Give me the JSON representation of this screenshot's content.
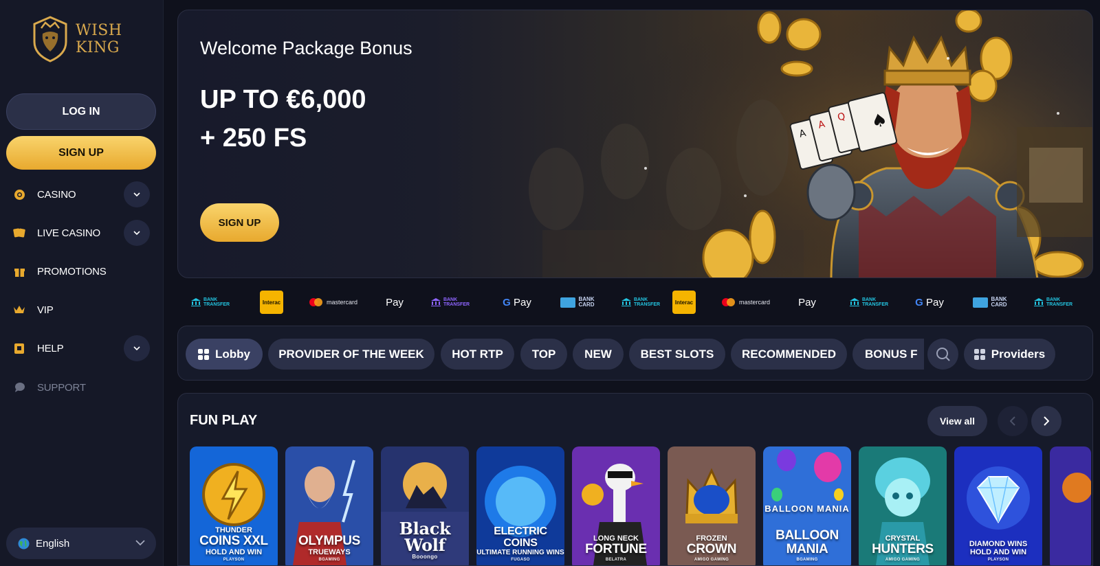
{
  "brand": {
    "line1": "WISH",
    "line2": "KING"
  },
  "auth": {
    "login_label": "LOG IN",
    "signup_label": "SIGN UP"
  },
  "sidebar": {
    "items": [
      {
        "label": "CASINO",
        "icon": "chip-icon",
        "expandable": true
      },
      {
        "label": "LIVE CASINO",
        "icon": "cards-icon",
        "expandable": true
      },
      {
        "label": "PROMOTIONS",
        "icon": "gift-icon",
        "expandable": false
      },
      {
        "label": "VIP",
        "icon": "crown-icon",
        "expandable": false
      },
      {
        "label": "HELP",
        "icon": "help-icon",
        "expandable": true
      },
      {
        "label": "SUPPORT",
        "icon": "chat-icon",
        "expandable": false
      }
    ],
    "language": "English"
  },
  "hero": {
    "title": "Welcome Package Bonus",
    "amount_line1": "UP TO €6,000",
    "amount_line2": "+ 250 FS",
    "cta": "SIGN UP"
  },
  "payments": {
    "bank_transfer": [
      "BANK",
      "TRANSFER"
    ],
    "interac": "Interac",
    "mastercard": "mastercard",
    "apple_pay": "Pay",
    "google_pay": "Pay",
    "bank_card": [
      "BANK",
      "CARD"
    ]
  },
  "tabs": {
    "items": [
      "Lobby",
      "PROVIDER OF THE WEEK",
      "HOT RTP",
      "TOP",
      "NEW",
      "BEST SLOTS",
      "RECOMMENDED",
      "BONUS F"
    ],
    "providers_label": "Providers"
  },
  "fun_play": {
    "title": "FUN PLAY",
    "view_all": "View all",
    "games": [
      {
        "pre": "THUNDER",
        "main": "COINS XXL",
        "sub": "HOLD AND WIN",
        "provider": "PLAYSON"
      },
      {
        "pre": "",
        "main": "OLYMPUS",
        "sub": "TRUEWAYS",
        "provider": "BGAMING"
      },
      {
        "pre": "",
        "main": "Black Wolf",
        "sub": "",
        "provider": "Booongo"
      },
      {
        "pre": "",
        "main": "ELECTRIC COINS",
        "sub": "ULTIMATE RUNNING WINS",
        "provider": "FUGASO"
      },
      {
        "pre": "LONG NECK",
        "main": "FORTUNE",
        "sub": "",
        "provider": "BELATRA"
      },
      {
        "pre": "FROZEN",
        "main": "CROWN",
        "sub": "",
        "provider": "AMIGO GAMING"
      },
      {
        "pre": "BALLOON MANIA",
        "main": "BALLOON MANIA",
        "sub": "",
        "provider": "BGAMING"
      },
      {
        "pre": "CRYSTAL",
        "main": "HUNTERS",
        "sub": "",
        "provider": "AMIGO GAMING"
      },
      {
        "pre": "DIAMOND WINS",
        "main": "HOLD AND WIN",
        "sub": "",
        "provider": "PLAYSON"
      }
    ]
  },
  "colors": {
    "accent": "#e8a92e",
    "bg": "#0f111c",
    "panel": "#161a2a",
    "chip": "#2b3048"
  }
}
